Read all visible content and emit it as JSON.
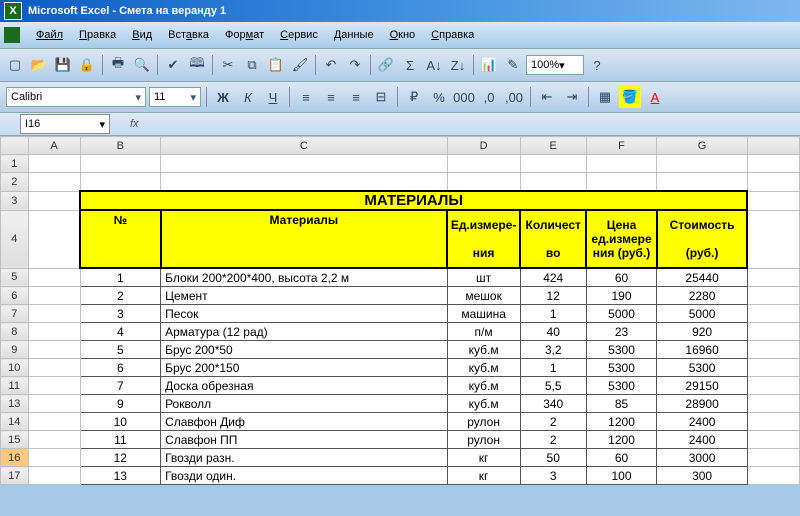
{
  "title": "Microsoft Excel - Смета на веранду 1",
  "menu": [
    "Файл",
    "Правка",
    "Вид",
    "Вставка",
    "Формат",
    "Сервис",
    "Данные",
    "Окно",
    "Справка"
  ],
  "font": {
    "name": "Calibri",
    "size": "11"
  },
  "zoom": "100%",
  "namebox": "I16",
  "cols": [
    "",
    "A",
    "B",
    "C",
    "D",
    "E",
    "F",
    "G",
    ""
  ],
  "section_title": "МАТЕРИАЛЫ",
  "headers": {
    "num": "№",
    "mat": "Материалы",
    "unit_t": "Ед.измере-",
    "unit_b": "ния",
    "qty_t": "Количест",
    "qty_b": "во",
    "price_t": "Цена",
    "price_m": "ед.измере",
    "price_b": "ния (руб.)",
    "cost_t": "Стоимость",
    "cost_b": "(руб.)"
  },
  "rows": [
    {
      "r": "5",
      "n": "1",
      "m": "Блоки 200*200*400, высота 2,2 м",
      "u": "шт",
      "q": "424",
      "p": "60",
      "c": "25440"
    },
    {
      "r": "6",
      "n": "2",
      "m": "Цемент",
      "u": "мешок",
      "q": "12",
      "p": "190",
      "c": "2280"
    },
    {
      "r": "7",
      "n": "3",
      "m": "Песок",
      "u": "машина",
      "q": "1",
      "p": "5000",
      "c": "5000"
    },
    {
      "r": "8",
      "n": "4",
      "m": "Арматура (12 рад)",
      "u": "п/м",
      "q": "40",
      "p": "23",
      "c": "920"
    },
    {
      "r": "9",
      "n": "5",
      "m": "Брус 200*50",
      "u": "куб.м",
      "q": "3,2",
      "p": "5300",
      "c": "16960"
    },
    {
      "r": "10",
      "n": "6",
      "m": "Брус 200*150",
      "u": "куб.м",
      "q": "1",
      "p": "5300",
      "c": "5300"
    },
    {
      "r": "11",
      "n": "7",
      "m": "Доска обрезная",
      "u": "куб.м",
      "q": "5,5",
      "p": "5300",
      "c": "29150"
    },
    {
      "r": "13",
      "n": "9",
      "m": "Рокволл",
      "u": "куб.м",
      "q": "340",
      "p": "85",
      "c": "28900"
    },
    {
      "r": "14",
      "n": "10",
      "m": "Славфон Диф",
      "u": "рулон",
      "q": "2",
      "p": "1200",
      "c": "2400"
    },
    {
      "r": "15",
      "n": "11",
      "m": "Славфон ПП",
      "u": "рулон",
      "q": "2",
      "p": "1200",
      "c": "2400"
    },
    {
      "r": "16",
      "n": "12",
      "m": "Гвозди разн.",
      "u": "кг",
      "q": "50",
      "p": "60",
      "c": "3000"
    },
    {
      "r": "17",
      "n": "13",
      "m": "Гвозди один.",
      "u": "кг",
      "q": "3",
      "p": "100",
      "c": "300"
    }
  ],
  "chart_data": {
    "type": "table",
    "title": "МАТЕРИАЛЫ",
    "columns": [
      "№",
      "Материалы",
      "Ед.измерения",
      "Количество",
      "Цена ед.измерения (руб.)",
      "Стоимость (руб.)"
    ],
    "data": [
      [
        1,
        "Блоки 200*200*400, высота 2,2 м",
        "шт",
        424,
        60,
        25440
      ],
      [
        2,
        "Цемент",
        "мешок",
        12,
        190,
        2280
      ],
      [
        3,
        "Песок",
        "машина",
        1,
        5000,
        5000
      ],
      [
        4,
        "Арматура (12 рад)",
        "п/м",
        40,
        23,
        920
      ],
      [
        5,
        "Брус 200*50",
        "куб.м",
        3.2,
        5300,
        16960
      ],
      [
        6,
        "Брус 200*150",
        "куб.м",
        1,
        5300,
        5300
      ],
      [
        7,
        "Доска обрезная",
        "куб.м",
        5.5,
        5300,
        29150
      ],
      [
        9,
        "Рокволл",
        "куб.м",
        340,
        85,
        28900
      ],
      [
        10,
        "Славфон Диф",
        "рулон",
        2,
        1200,
        2400
      ],
      [
        11,
        "Славфон ПП",
        "рулон",
        2,
        1200,
        2400
      ],
      [
        12,
        "Гвозди разн.",
        "кг",
        50,
        60,
        3000
      ],
      [
        13,
        "Гвозди один.",
        "кг",
        3,
        100,
        300
      ]
    ]
  }
}
